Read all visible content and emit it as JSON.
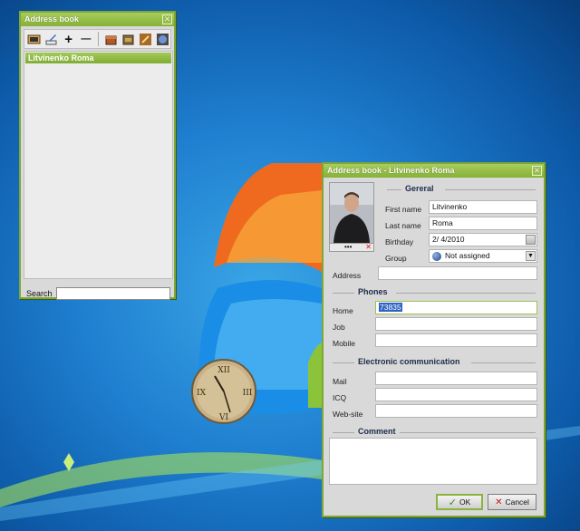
{
  "list_window": {
    "title": "Address book",
    "close_glyph": "✕",
    "toolbar": {
      "tools": [
        {
          "name": "open-book-icon"
        },
        {
          "name": "edit-icon"
        },
        {
          "name": "add-icon",
          "glyph": "+"
        },
        {
          "name": "remove-icon",
          "glyph": "—"
        },
        {
          "name": "chest-icon"
        },
        {
          "name": "chest-2-icon"
        },
        {
          "name": "tools-icon"
        },
        {
          "name": "globe-settings-icon"
        }
      ]
    },
    "contacts": [
      "Litvinenko  Roma"
    ],
    "search": {
      "label": "Search",
      "value": ""
    }
  },
  "edit_window": {
    "title": "Address book - Litvinenko  Roma",
    "close_glyph": "✕",
    "photo_dots": "•••",
    "sections": {
      "general": "Gereral",
      "phones": "Phones",
      "electronic": "Electronic communication",
      "comment": "Comment"
    },
    "fields": {
      "first_name": {
        "label": "First name",
        "value": "Litvinenko"
      },
      "last_name": {
        "label": "Last name",
        "value": "Roma"
      },
      "birthday": {
        "label": "Birthday",
        "value": "2/ 4/2010"
      },
      "group": {
        "label": "Group",
        "value": "Not assigned"
      },
      "address": {
        "label": "Address",
        "value": ""
      },
      "home": {
        "label": "Home",
        "value": "73835"
      },
      "job": {
        "label": "Job",
        "value": ""
      },
      "mobile": {
        "label": "Mobile",
        "value": ""
      },
      "mail": {
        "label": "Mail",
        "value": ""
      },
      "icq": {
        "label": "ICQ",
        "value": ""
      },
      "website": {
        "label": "Web-site",
        "value": ""
      }
    },
    "buttons": {
      "ok": "OK",
      "cancel": "Cancel"
    }
  },
  "colors": {
    "accent_green": "#86b137",
    "selection_blue": "#2f62c5"
  }
}
